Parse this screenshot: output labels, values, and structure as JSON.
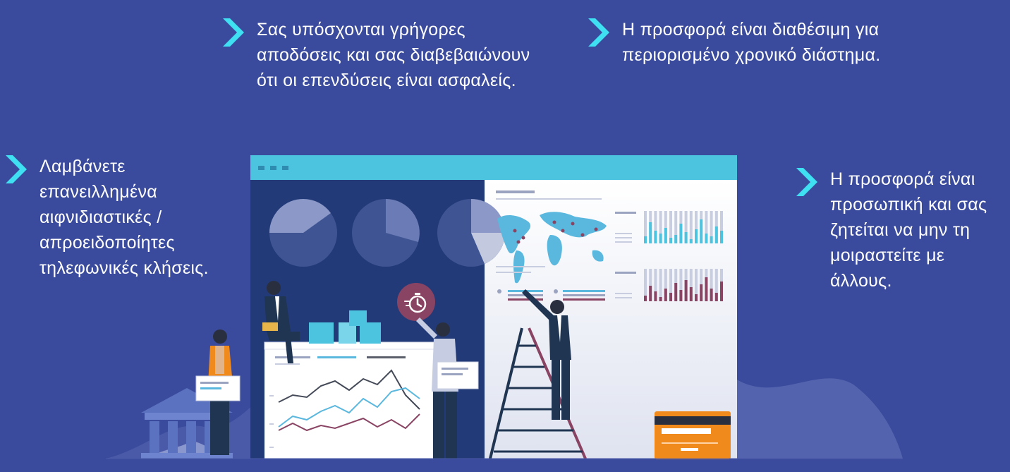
{
  "bullets": [
    {
      "id": "b1",
      "text": "Σας υπόσχονται γρήγορες αποδόσεις και σας διαβεβαιώνουν ότι οι επενδύσεις είναι ασφαλείς."
    },
    {
      "id": "b2",
      "text": "Η προσφορά είναι διαθέσιμη για περιορισμένο χρονικό διάστημα."
    },
    {
      "id": "b3",
      "text": "Λαμβάνετε επανειλλημένα αιφνιδιαστικές / απροειδοποίητες τηλεφωνικές κλήσεις."
    },
    {
      "id": "b4",
      "text": "Η προσφορά είναι προσωπική και σας ζητείται να μην τη μοιραστείτε με άλλους."
    }
  ],
  "colors": {
    "background": "#3a4a9c",
    "chevron": "#3fe0f2",
    "window_bar": "#4cc3df",
    "dark_panel": "#233a78",
    "accent_orange": "#f08a1c",
    "accent_plum": "#8a4463"
  },
  "icons": {
    "chevron": "chevron-right-icon",
    "stopwatch": "stopwatch-icon",
    "bank": "bank-building-icon",
    "card": "credit-card-icon",
    "map": "world-map-icon"
  }
}
